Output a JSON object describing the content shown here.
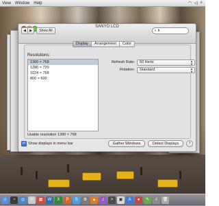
{
  "menubar": {
    "items": [
      "View",
      "Window",
      "Help"
    ]
  },
  "window": {
    "title": "SANYO LCD",
    "nav": {
      "back": "◀",
      "forward": "▶",
      "show_all": "Show All"
    },
    "search": {
      "value": "k",
      "placeholder": ""
    },
    "tabs": [
      "Display",
      "Arrangement",
      "Color"
    ],
    "active_tab": "Display",
    "resolutions_label": "Resolutions:",
    "resolutions": [
      "1360 × 768",
      "1280 × 720",
      "1024 × 768",
      "800 × 600"
    ],
    "selected_resolution": "1360 × 768",
    "refresh_rate": {
      "label": "Refresh Rate:",
      "value": "60 Hertz"
    },
    "rotation": {
      "label": "Rotation:",
      "value": "Standard"
    },
    "usable_resolution": "Usable resolution 1280 × 768",
    "show_displays_checkbox": {
      "label": "Show displays in menu bar",
      "checked": true
    },
    "buttons": {
      "gather_windows": "Gather Windows",
      "detect_displays": "Detect Displays",
      "help": "?"
    }
  },
  "colors": {
    "accent": "#3b6fd1",
    "window_bg": "#e6e6e6",
    "taxi": "#e4b21b"
  }
}
